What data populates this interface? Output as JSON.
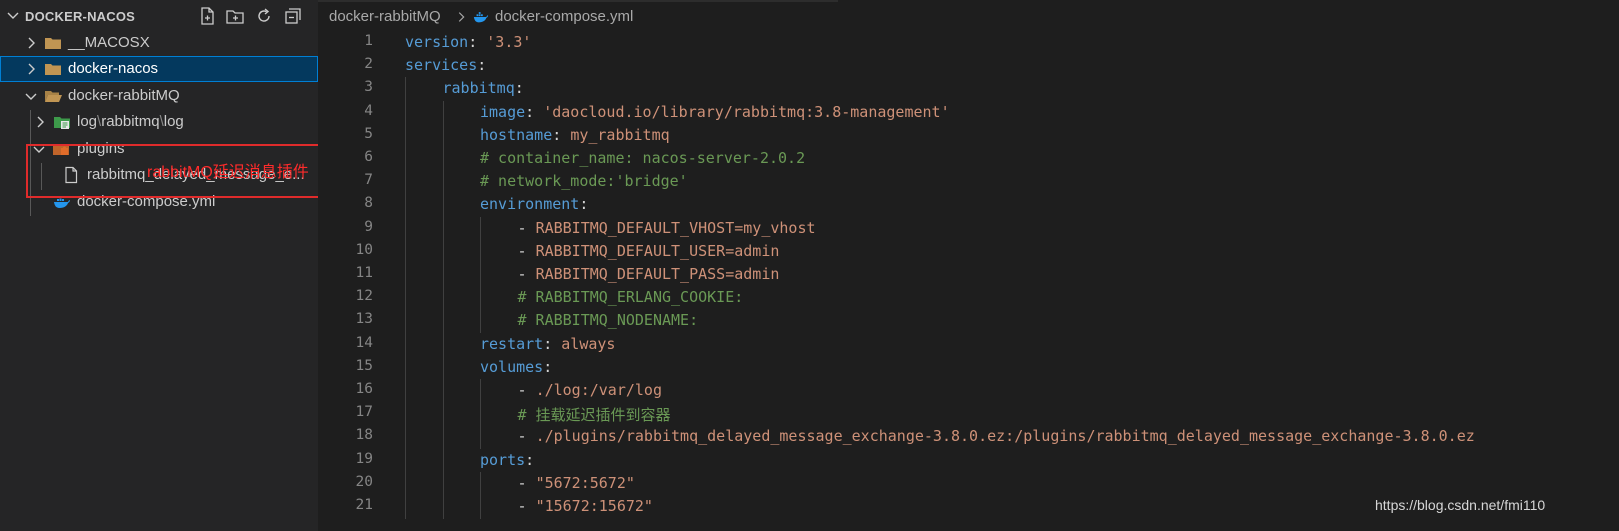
{
  "sidebar": {
    "title": "DOCKER-NACOS",
    "actions": [
      {
        "name": "new-file-icon"
      },
      {
        "name": "new-folder-icon"
      },
      {
        "name": "refresh-icon"
      },
      {
        "name": "collapse-all-icon"
      }
    ],
    "items": [
      {
        "label": "__MACOSX",
        "icon": "folder-icon"
      },
      {
        "label": "docker-nacos",
        "icon": "folder-icon",
        "selected": true
      },
      {
        "label": "docker-rabbitMQ",
        "icon": "folder-open-icon"
      },
      {
        "label": "log",
        "path_rest": [
          "rabbitmq",
          "log"
        ],
        "icon": "log-folder-icon"
      },
      {
        "label": "plugins",
        "icon": "plugins-folder-icon"
      },
      {
        "label": "rabbitmq_delayed_message_e...",
        "icon": "file-icon"
      },
      {
        "label": "docker-compose.yml",
        "icon": "docker-icon"
      }
    ],
    "path_separator": "\\",
    "annotation": "rabbitMQ延迟消息插件"
  },
  "breadcrumb": {
    "folder": "docker-rabbitMQ",
    "file": "docker-compose.yml"
  },
  "colors": {
    "keyword": "#569cd6",
    "string": "#ce9178",
    "comment": "#6a9955",
    "annotation": "#e02b2b"
  },
  "editor": {
    "lines": [
      {
        "n": "1",
        "indent": 0,
        "tokens": [
          [
            "k",
            "version"
          ],
          [
            "p",
            ": "
          ],
          [
            "s",
            "'3.3'"
          ]
        ]
      },
      {
        "n": "2",
        "indent": 0,
        "tokens": [
          [
            "k",
            "services"
          ],
          [
            "p",
            ":"
          ]
        ]
      },
      {
        "n": "3",
        "indent": 1,
        "tokens": [
          [
            "k",
            "rabbitmq"
          ],
          [
            "p",
            ":"
          ]
        ]
      },
      {
        "n": "4",
        "indent": 2,
        "tokens": [
          [
            "k",
            "image"
          ],
          [
            "p",
            ": "
          ],
          [
            "s",
            "'daocloud.io/library/rabbitmq:3.8-management'"
          ]
        ]
      },
      {
        "n": "5",
        "indent": 2,
        "tokens": [
          [
            "k",
            "hostname"
          ],
          [
            "p",
            ": "
          ],
          [
            "s",
            "my_rabbitmq"
          ]
        ]
      },
      {
        "n": "6",
        "indent": 2,
        "tokens": [
          [
            "c",
            "# container_name: nacos-server-2.0.2"
          ]
        ]
      },
      {
        "n": "7",
        "indent": 2,
        "tokens": [
          [
            "c",
            "# network_mode:'bridge'"
          ]
        ]
      },
      {
        "n": "8",
        "indent": 2,
        "tokens": [
          [
            "k",
            "environment"
          ],
          [
            "p",
            ":"
          ]
        ]
      },
      {
        "n": "9",
        "indent": 3,
        "tokens": [
          [
            "p",
            "- "
          ],
          [
            "s",
            "RABBITMQ_DEFAULT_VHOST=my_vhost"
          ]
        ]
      },
      {
        "n": "10",
        "indent": 3,
        "tokens": [
          [
            "p",
            "- "
          ],
          [
            "s",
            "RABBITMQ_DEFAULT_USER=admin"
          ]
        ]
      },
      {
        "n": "11",
        "indent": 3,
        "tokens": [
          [
            "p",
            "- "
          ],
          [
            "s",
            "RABBITMQ_DEFAULT_PASS=admin"
          ]
        ]
      },
      {
        "n": "12",
        "indent": 3,
        "tokens": [
          [
            "c",
            "# RABBITMQ_ERLANG_COOKIE:"
          ]
        ]
      },
      {
        "n": "13",
        "indent": 3,
        "tokens": [
          [
            "c",
            "# RABBITMQ_NODENAME:"
          ]
        ]
      },
      {
        "n": "14",
        "indent": 2,
        "tokens": [
          [
            "k",
            "restart"
          ],
          [
            "p",
            ": "
          ],
          [
            "s",
            "always"
          ]
        ]
      },
      {
        "n": "15",
        "indent": 2,
        "tokens": [
          [
            "k",
            "volumes"
          ],
          [
            "p",
            ":"
          ]
        ]
      },
      {
        "n": "16",
        "indent": 3,
        "tokens": [
          [
            "p",
            "- "
          ],
          [
            "s",
            "./log:/var/log"
          ]
        ]
      },
      {
        "n": "17",
        "indent": 3,
        "tokens": [
          [
            "c",
            "# 挂载延迟插件到容器"
          ]
        ]
      },
      {
        "n": "18",
        "indent": 3,
        "tokens": [
          [
            "p",
            "- "
          ],
          [
            "s",
            "./plugins/rabbitmq_delayed_message_exchange-3.8.0.ez:/plugins/rabbitmq_delayed_message_exchange-3.8.0.ez"
          ]
        ]
      },
      {
        "n": "19",
        "indent": 2,
        "tokens": [
          [
            "k",
            "ports"
          ],
          [
            "p",
            ":"
          ]
        ]
      },
      {
        "n": "20",
        "indent": 3,
        "tokens": [
          [
            "p",
            "- "
          ],
          [
            "s",
            "\"5672:5672\""
          ]
        ]
      },
      {
        "n": "21",
        "indent": 3,
        "tokens": [
          [
            "p",
            "- "
          ],
          [
            "s",
            "\"15672:15672\""
          ]
        ]
      }
    ]
  },
  "watermark": "https://blog.csdn.net/fmi110"
}
